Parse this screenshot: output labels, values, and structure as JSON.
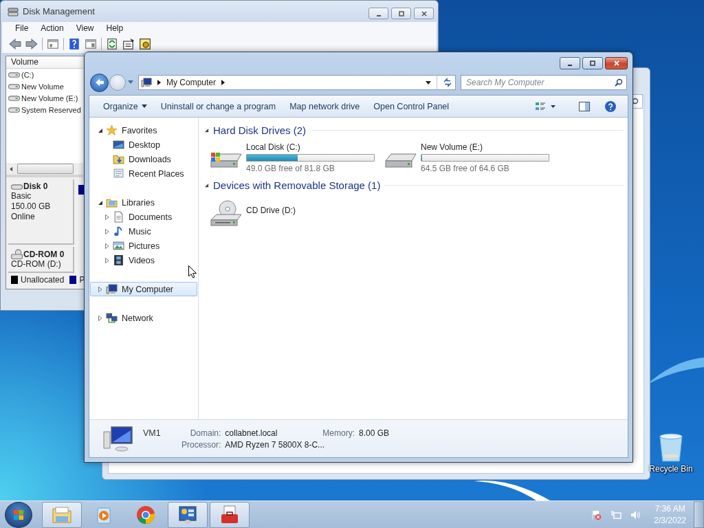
{
  "disk_management": {
    "title": "Disk Management",
    "menu": [
      "File",
      "Action",
      "View",
      "Help"
    ],
    "volume_list": {
      "column": "Volume",
      "rows": [
        "(C:)",
        "New Volume",
        "New Volume (E:)",
        "System Reserved"
      ]
    },
    "disks": [
      {
        "kind": "disk",
        "name": "Disk 0",
        "lines": [
          "Basic",
          "150.00 GB",
          "Online"
        ]
      },
      {
        "kind": "cdrom",
        "name": "CD-ROM 0",
        "lines": [
          "CD-ROM (D:)"
        ]
      }
    ],
    "legend": [
      {
        "label": "Unallocated",
        "color": "#000000"
      },
      {
        "label": "P",
        "color": "#00008b"
      }
    ]
  },
  "explorer": {
    "address": "My Computer",
    "search": {
      "placeholder": "Search My Computer"
    },
    "commands": [
      {
        "label": "Organize",
        "dropdown": true
      },
      {
        "label": "Uninstall or change a program",
        "dropdown": false
      },
      {
        "label": "Map network drive",
        "dropdown": false
      },
      {
        "label": "Open Control Panel",
        "dropdown": false
      }
    ],
    "nav": [
      {
        "kind": "favorites",
        "label": "Favorites",
        "expanded": true,
        "selected": false,
        "children": [
          {
            "kind": "desktop",
            "label": "Desktop",
            "selected": false
          },
          {
            "kind": "downloads",
            "label": "Downloads",
            "selected": false
          },
          {
            "kind": "recent",
            "label": "Recent Places",
            "selected": false
          }
        ]
      },
      {
        "kind": "libraries",
        "label": "Libraries",
        "expanded": true,
        "selected": false,
        "children": [
          {
            "kind": "documents",
            "label": "Documents",
            "expanded": false,
            "selected": false
          },
          {
            "kind": "music",
            "label": "Music",
            "expanded": false,
            "selected": false
          },
          {
            "kind": "pictures",
            "label": "Pictures",
            "expanded": false,
            "selected": false
          },
          {
            "kind": "videos",
            "label": "Videos",
            "expanded": false,
            "selected": false
          }
        ]
      },
      {
        "kind": "computer",
        "label": "My Computer",
        "expanded": false,
        "selected": true
      },
      {
        "kind": "network",
        "label": "Network",
        "expanded": false,
        "selected": false
      }
    ],
    "groups": [
      {
        "title": "Hard Disk Drives (2)",
        "expanded": true,
        "items": [
          {
            "kind": "system_disk",
            "name": "Local Disk (C:)",
            "level": 0.4,
            "free": "49.0 GB free of 81.8 GB"
          },
          {
            "kind": "disk",
            "name": "New Volume (E:)",
            "level": 0.002,
            "free": "64.5 GB free of 64.6 GB"
          }
        ]
      },
      {
        "title": "Devices with Removable Storage (1)",
        "expanded": true,
        "items": [
          {
            "kind": "cd",
            "name": "CD Drive (D:)"
          }
        ]
      }
    ],
    "details": {
      "name": "VM1",
      "fields": [
        {
          "label": "Domain:",
          "value": "collabnet.local"
        },
        {
          "label": "Memory:",
          "value": "8.00 GB"
        },
        {
          "label": "Processor:",
          "value": "AMD Ryzen 7 5800X 8-C..."
        }
      ]
    }
  },
  "desktop_icons": [
    {
      "kind": "recycle_bin",
      "label": "Recycle Bin"
    }
  ],
  "taskbar": {
    "apps": [
      {
        "kind": "folder",
        "running": true
      },
      {
        "kind": "media",
        "running": false
      },
      {
        "kind": "browser",
        "running": false
      },
      {
        "kind": "control",
        "running": true
      },
      {
        "kind": "toolbox",
        "running": true
      }
    ],
    "time": "7:36 AM",
    "date": "2/3/2022"
  }
}
